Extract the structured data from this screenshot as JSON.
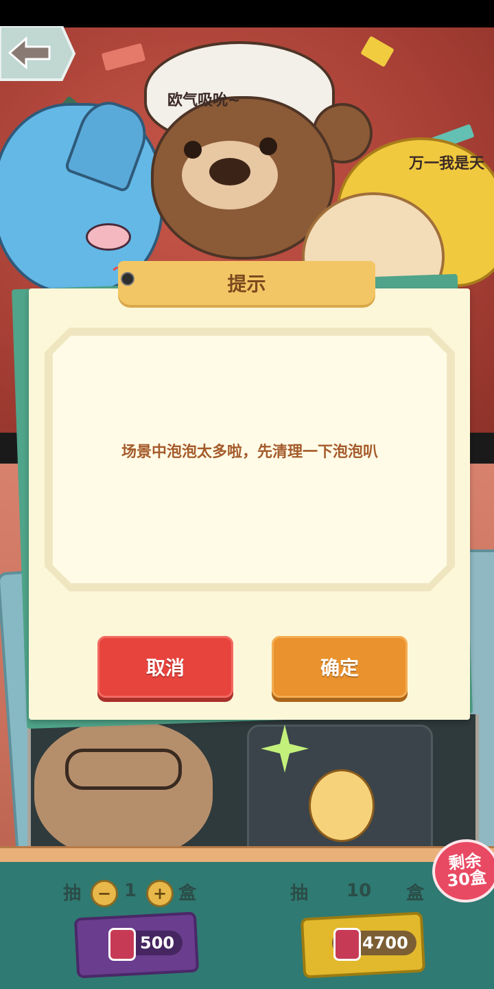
{
  "banner": {
    "bubble_left": "欧气吸吮~",
    "bubble_right": "万一我是天"
  },
  "dialog": {
    "title": "提示",
    "message": "场景中泡泡太多啦，先清理一下泡泡叭",
    "cancel_label": "取消",
    "confirm_label": "确定"
  },
  "remaining": {
    "line1": "剩余",
    "line2": "30盒"
  },
  "draw_single": {
    "prefix": "抽",
    "minus": "−",
    "count": "1",
    "plus": "+",
    "suffix": "盒",
    "price": "500"
  },
  "draw_ten": {
    "prefix": "抽",
    "count": "10",
    "suffix": "盒",
    "price": "4700"
  },
  "colors": {
    "cancel": "#e8443e",
    "confirm": "#ea922e",
    "dialog_bg": "#fdf7d9",
    "panel_bg": "#2f7a72"
  }
}
